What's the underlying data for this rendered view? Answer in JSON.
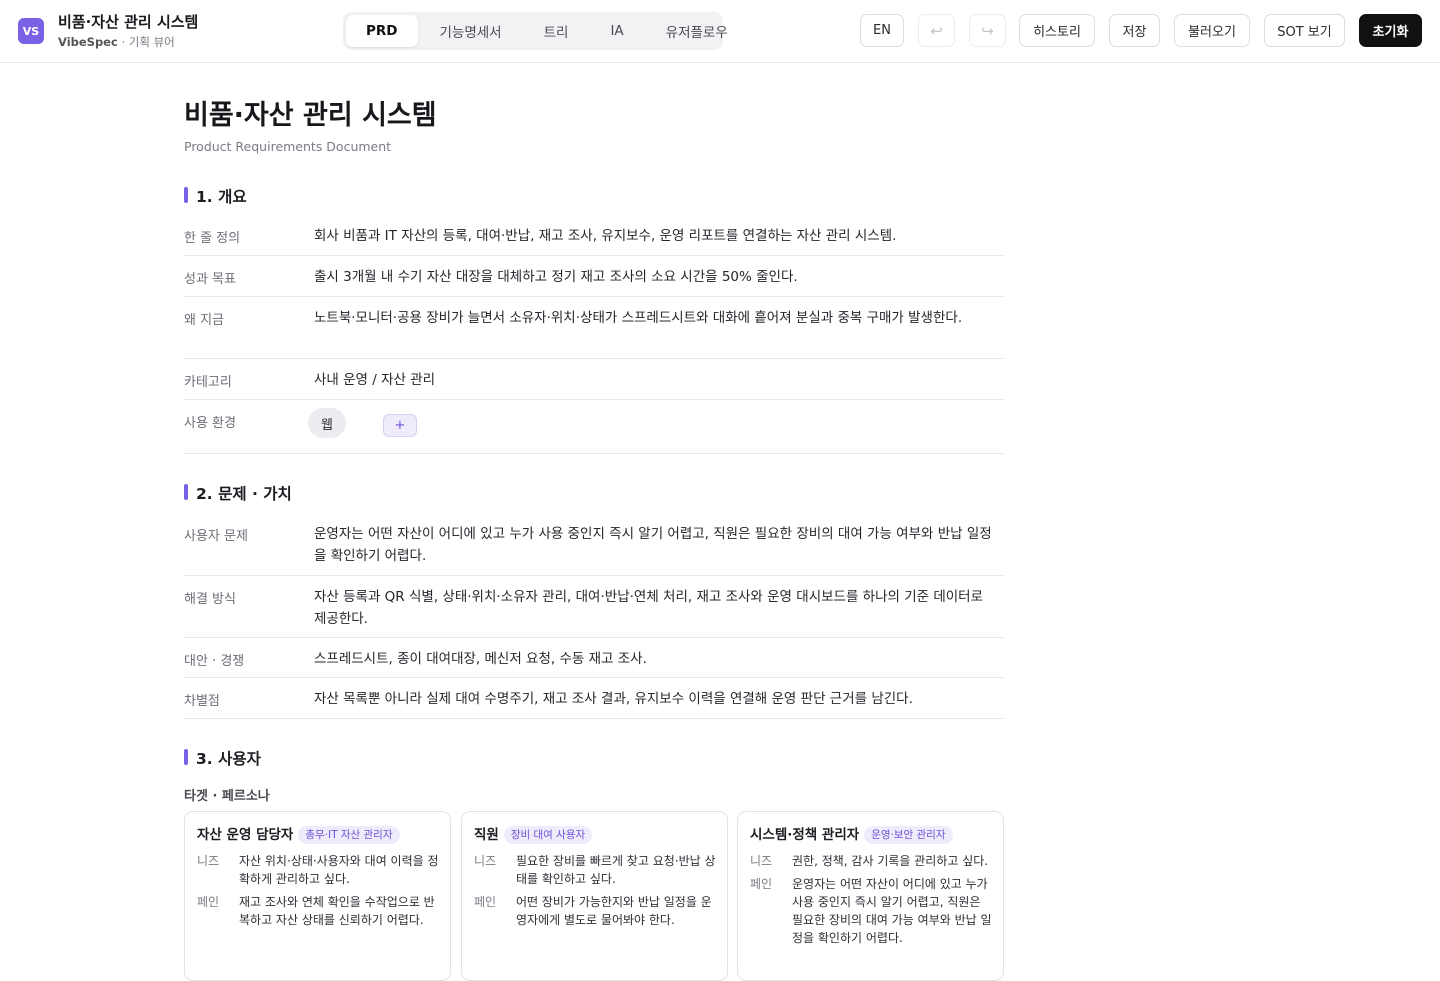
{
  "header": {
    "logo": "VS",
    "title": "비품·자산 관리 시스템",
    "brand": "VibeSpec",
    "brand_suffix": " · 기획 뷰어",
    "tabs": [
      "PRD",
      "기능명세서",
      "트리",
      "IA",
      "유저플로우"
    ],
    "active_tab": "PRD",
    "lang": "EN",
    "undo_icon": "↩",
    "redo_icon": "↪",
    "history": "히스토리",
    "save": "저장",
    "load": "불러오기",
    "sot": "SOT 보기",
    "reset": "초기화"
  },
  "doc": {
    "title": "비품·자산 관리 시스템",
    "subtitle": "Product Requirements Document",
    "sections": [
      {
        "heading": "1. 개요",
        "rows": [
          {
            "k": "한 줄 정의",
            "v": "회사 비품과 IT 자산의 등록, 대여·반납, 재고 조사, 유지보수, 운영 리포트를 연결하는 자산 관리 시스템."
          },
          {
            "k": "성과 목표",
            "v": "출시 3개월 내 수기 자산 대장을 대체하고 정기 재고 조사의 소요 시간을 50% 줄인다."
          },
          {
            "k": "왜 지금",
            "v": "노트북·모니터·공용 장비가 늘면서 소유자·위치·상태가 스프레드시트와 대화에 흩어져 분실과 중복 구매가 발생한다."
          },
          {
            "k": "카테고리",
            "v": "사내 운영 / 자산 관리"
          },
          {
            "k": "사용 환경",
            "chips": [
              "웹"
            ],
            "add": "+"
          }
        ]
      },
      {
        "heading": "2. 문제 · 가치",
        "rows": [
          {
            "k": "사용자 문제",
            "v": "운영자는 어떤 자산이 어디에 있고 누가 사용 중인지 즉시 알기 어렵고, 직원은 필요한 장비의 대여 가능 여부와 반납 일정을 확인하기 어렵다."
          },
          {
            "k": "해결 방식",
            "v": "자산 등록과 QR 식별, 상태·위치·소유자 관리, 대여·반납·연체 처리, 재고 조사와 운영 대시보드를 하나의 기준 데이터로 제공한다."
          },
          {
            "k": "대안 · 경쟁",
            "v": "스프레드시트, 종이 대여대장, 메신저 요청, 수동 재고 조사."
          },
          {
            "k": "차별점",
            "v": "자산 목록뿐 아니라 실제 대여 수명주기, 재고 조사 결과, 유지보수 이력을 연결해 운영 판단 근거를 남긴다."
          }
        ]
      },
      {
        "heading": "3. 사용자",
        "subheading": "타겟 · 페르소나",
        "personas": [
          {
            "name": "자산 운영 담당자",
            "tag": "총무·IT 자산 관리자",
            "needs_label": "니즈",
            "needs": "자산 위치·상태·사용자와 대여 이력을 정확하게 관리하고 싶다.",
            "pain_label": "페인",
            "pain": "재고 조사와 연체 확인을 수작업으로 반복하고 자산 상태를 신뢰하기 어렵다."
          },
          {
            "name": "직원",
            "tag": "장비 대여 사용자",
            "needs_label": "니즈",
            "needs": "필요한 장비를 빠르게 찾고 요청·반납 상태를 확인하고 싶다.",
            "pain_label": "페인",
            "pain": "어떤 장비가 가능한지와 반납 일정을 운영자에게 별도로 물어봐야 한다."
          },
          {
            "name": "시스템·정책 관리자",
            "tag": "운영·보안 관리자",
            "needs_label": "니즈",
            "needs": "권한, 정책, 감사 기록을 관리하고 싶다.",
            "pain_label": "페인",
            "pain": "운영자는 어떤 자산이 어디에 있고 누가 사용 중인지 즉시 알기 어렵고, 직원은 필요한 장비의 대여 가능 여부와 반납 일정을 확인하기 어렵다."
          }
        ]
      }
    ]
  },
  "colors": {
    "accent": "#7b61e6",
    "dark_button": "#111111",
    "tag_bg": "#efebfb"
  }
}
